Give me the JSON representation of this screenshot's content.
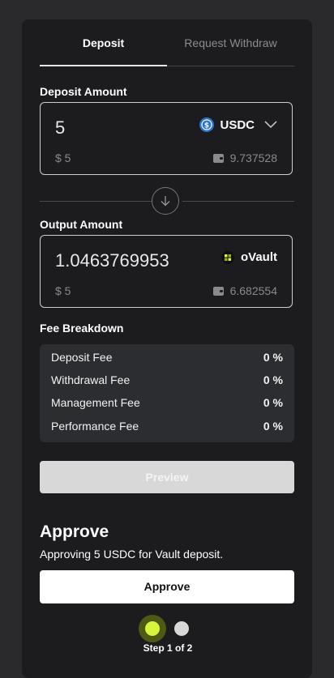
{
  "tabs": {
    "deposit": "Deposit",
    "withdraw": "Request Withdraw"
  },
  "deposit": {
    "label": "Deposit Amount",
    "amount": "5",
    "token": "USDC",
    "token_icon": "usdc-icon",
    "usd_value": "$ 5",
    "balance": "9.737528"
  },
  "output": {
    "label": "Output Amount",
    "amount": "1.04637699537",
    "token": "oVault",
    "token_icon": "ovault-icon",
    "usd_value": "$ 5",
    "balance": "6.682554"
  },
  "fees": {
    "title": "Fee Breakdown",
    "rows": [
      {
        "name": "Deposit Fee",
        "value": "0 %"
      },
      {
        "name": "Withdrawal Fee",
        "value": "0 %"
      },
      {
        "name": "Management Fee",
        "value": "0 %"
      },
      {
        "name": "Performance Fee",
        "value": "0 %"
      }
    ]
  },
  "preview_label": "Preview",
  "approve": {
    "title": "Approve",
    "description": "Approving 5 USDC for Vault deposit.",
    "button": "Approve"
  },
  "stepper": {
    "text": "Step 1 of 2"
  },
  "colors": {
    "accent": "#d7f53a",
    "usdc": "#2775ca",
    "background": "#1c1c1e"
  }
}
